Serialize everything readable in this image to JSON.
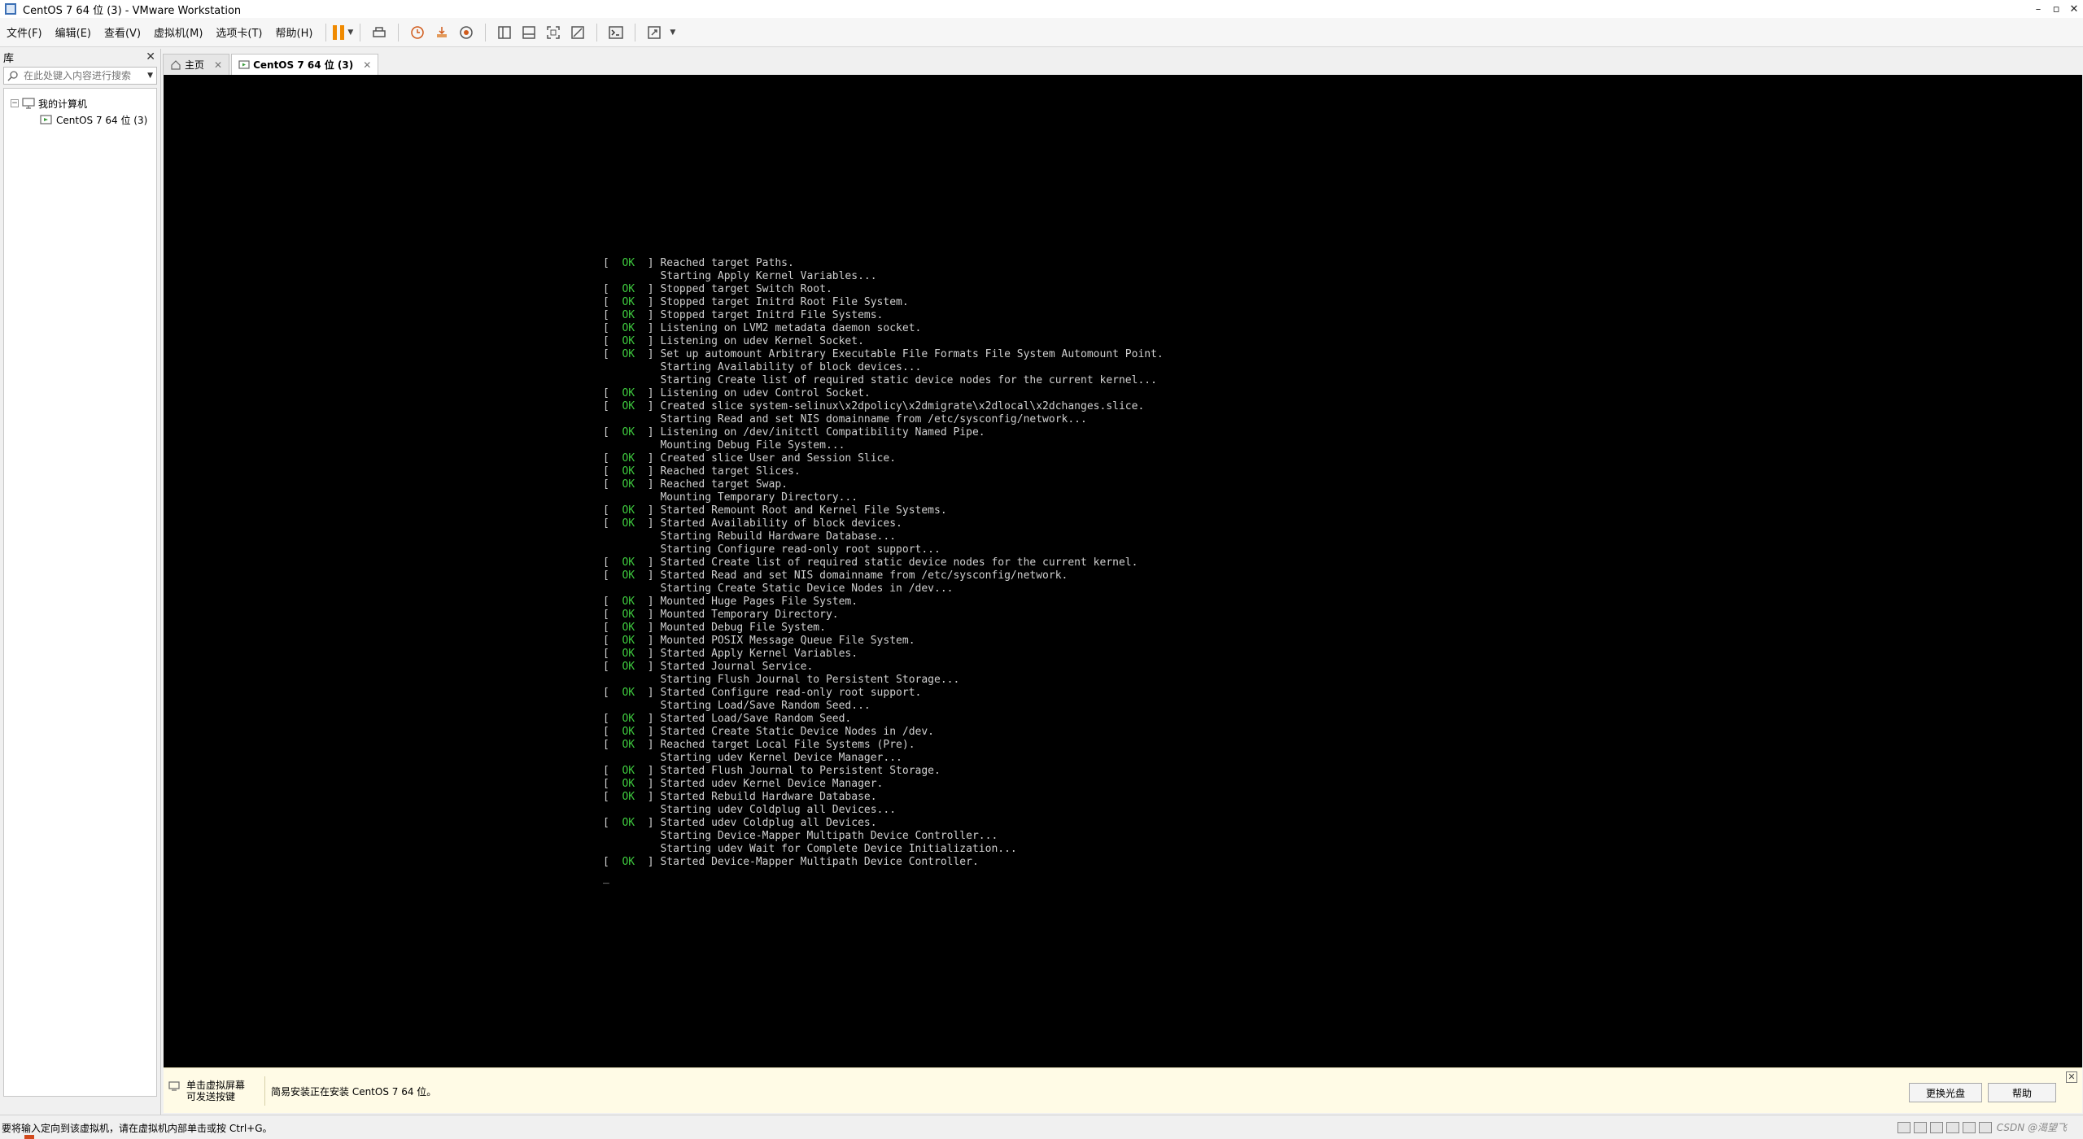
{
  "window": {
    "title": "CentOS 7 64 位 (3) - VMware Workstation"
  },
  "menu": {
    "items": [
      "文件(F)",
      "编辑(E)",
      "查看(V)",
      "虚拟机(M)",
      "选项卡(T)",
      "帮助(H)"
    ]
  },
  "toolbar": {
    "accent_color": "#f08a00",
    "icons": [
      "pause-icon",
      "send-ctrl-alt-del-icon",
      "snapshot-icon",
      "revert-snapshot-icon",
      "snapshot-manager-icon",
      "library-view-icon",
      "thumbnail-view-icon",
      "fullscreen-icon",
      "unity-icon",
      "console-view-icon",
      "stretch-icon"
    ]
  },
  "library": {
    "header": "库",
    "search_placeholder": "在此处键入内容进行搜索",
    "tree": {
      "root_label": "我的计算机",
      "vm_label": "CentOS 7 64 位 (3)"
    }
  },
  "tabs": [
    {
      "label": "主页"
    },
    {
      "label": "CentOS 7 64 位 (3)"
    }
  ],
  "console": {
    "ok_text": "OK",
    "ok_color": "#3ec93e",
    "cursor": "_",
    "lines": [
      {
        "ok": true,
        "text": "Reached target Paths."
      },
      {
        "ok": false,
        "text": "Starting Apply Kernel Variables..."
      },
      {
        "ok": true,
        "text": "Stopped target Switch Root."
      },
      {
        "ok": true,
        "text": "Stopped target Initrd Root File System."
      },
      {
        "ok": true,
        "text": "Stopped target Initrd File Systems."
      },
      {
        "ok": true,
        "text": "Listening on LVM2 metadata daemon socket."
      },
      {
        "ok": true,
        "text": "Listening on udev Kernel Socket."
      },
      {
        "ok": true,
        "text": "Set up automount Arbitrary Executable File Formats File System Automount Point."
      },
      {
        "ok": false,
        "text": "Starting Availability of block devices..."
      },
      {
        "ok": false,
        "text": "Starting Create list of required static device nodes for the current kernel..."
      },
      {
        "ok": true,
        "text": "Listening on udev Control Socket."
      },
      {
        "ok": true,
        "text": "Created slice system-selinux\\x2dpolicy\\x2dmigrate\\x2dlocal\\x2dchanges.slice."
      },
      {
        "ok": false,
        "text": "Starting Read and set NIS domainname from /etc/sysconfig/network..."
      },
      {
        "ok": true,
        "text": "Listening on /dev/initctl Compatibility Named Pipe."
      },
      {
        "ok": false,
        "text": "Mounting Debug File System..."
      },
      {
        "ok": true,
        "text": "Created slice User and Session Slice."
      },
      {
        "ok": true,
        "text": "Reached target Slices."
      },
      {
        "ok": true,
        "text": "Reached target Swap."
      },
      {
        "ok": false,
        "text": "Mounting Temporary Directory..."
      },
      {
        "ok": true,
        "text": "Started Remount Root and Kernel File Systems."
      },
      {
        "ok": true,
        "text": "Started Availability of block devices."
      },
      {
        "ok": false,
        "text": "Starting Rebuild Hardware Database..."
      },
      {
        "ok": false,
        "text": "Starting Configure read-only root support..."
      },
      {
        "ok": true,
        "text": "Started Create list of required static device nodes for the current kernel."
      },
      {
        "ok": true,
        "text": "Started Read and set NIS domainname from /etc/sysconfig/network."
      },
      {
        "ok": false,
        "text": "Starting Create Static Device Nodes in /dev..."
      },
      {
        "ok": true,
        "text": "Mounted Huge Pages File System."
      },
      {
        "ok": true,
        "text": "Mounted Temporary Directory."
      },
      {
        "ok": true,
        "text": "Mounted Debug File System."
      },
      {
        "ok": true,
        "text": "Mounted POSIX Message Queue File System."
      },
      {
        "ok": true,
        "text": "Started Apply Kernel Variables."
      },
      {
        "ok": true,
        "text": "Started Journal Service."
      },
      {
        "ok": false,
        "text": "Starting Flush Journal to Persistent Storage..."
      },
      {
        "ok": true,
        "text": "Started Configure read-only root support."
      },
      {
        "ok": false,
        "text": "Starting Load/Save Random Seed..."
      },
      {
        "ok": true,
        "text": "Started Load/Save Random Seed."
      },
      {
        "ok": true,
        "text": "Started Create Static Device Nodes in /dev."
      },
      {
        "ok": true,
        "text": "Reached target Local File Systems (Pre)."
      },
      {
        "ok": false,
        "text": "Starting udev Kernel Device Manager..."
      },
      {
        "ok": true,
        "text": "Started Flush Journal to Persistent Storage."
      },
      {
        "ok": true,
        "text": "Started udev Kernel Device Manager."
      },
      {
        "ok": true,
        "text": "Started Rebuild Hardware Database."
      },
      {
        "ok": false,
        "text": "Starting udev Coldplug all Devices..."
      },
      {
        "ok": true,
        "text": "Started udev Coldplug all Devices."
      },
      {
        "ok": false,
        "text": "Starting Device-Mapper Multipath Device Controller..."
      },
      {
        "ok": false,
        "text": "Starting udev Wait for Complete Device Initialization..."
      },
      {
        "ok": true,
        "text": "Started Device-Mapper Multipath Device Controller."
      }
    ]
  },
  "hintbar": {
    "click_hint_line1": "单击虚拟屏幕",
    "click_hint_line2": "可发送按键",
    "install_text": "简易安装正在安装 CentOS 7 64 位。",
    "change_disc_label": "更换光盘",
    "help_label": "帮助"
  },
  "statusbar": {
    "text": "要将输入定向到该虚拟机，请在虚拟机内部单击或按 Ctrl+G。",
    "watermark": "CSDN @渴望飞"
  }
}
